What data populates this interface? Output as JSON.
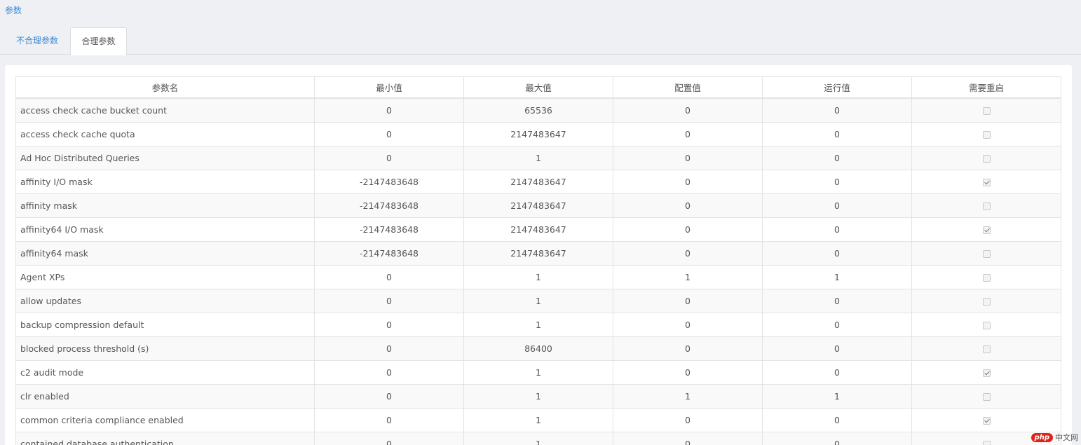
{
  "page": {
    "title": "参数"
  },
  "tabs": [
    {
      "label": "不合理参数",
      "active": false
    },
    {
      "label": "合理参数",
      "active": true
    }
  ],
  "table": {
    "columns": [
      "参数名",
      "最小值",
      "最大值",
      "配置值",
      "运行值",
      "需要重启"
    ],
    "rows": [
      {
        "name": "access check cache bucket count",
        "min": "0",
        "max": "65536",
        "config": "0",
        "run": "0",
        "restart": false
      },
      {
        "name": "access check cache quota",
        "min": "0",
        "max": "2147483647",
        "config": "0",
        "run": "0",
        "restart": false
      },
      {
        "name": "Ad Hoc Distributed Queries",
        "min": "0",
        "max": "1",
        "config": "0",
        "run": "0",
        "restart": false
      },
      {
        "name": "affinity I/O mask",
        "min": "-2147483648",
        "max": "2147483647",
        "config": "0",
        "run": "0",
        "restart": true
      },
      {
        "name": "affinity mask",
        "min": "-2147483648",
        "max": "2147483647",
        "config": "0",
        "run": "0",
        "restart": false
      },
      {
        "name": "affinity64 I/O mask",
        "min": "-2147483648",
        "max": "2147483647",
        "config": "0",
        "run": "0",
        "restart": true
      },
      {
        "name": "affinity64 mask",
        "min": "-2147483648",
        "max": "2147483647",
        "config": "0",
        "run": "0",
        "restart": false
      },
      {
        "name": "Agent XPs",
        "min": "0",
        "max": "1",
        "config": "1",
        "run": "1",
        "restart": false
      },
      {
        "name": "allow updates",
        "min": "0",
        "max": "1",
        "config": "0",
        "run": "0",
        "restart": false
      },
      {
        "name": "backup compression default",
        "min": "0",
        "max": "1",
        "config": "0",
        "run": "0",
        "restart": false
      },
      {
        "name": "blocked process threshold (s)",
        "min": "0",
        "max": "86400",
        "config": "0",
        "run": "0",
        "restart": false
      },
      {
        "name": "c2 audit mode",
        "min": "0",
        "max": "1",
        "config": "0",
        "run": "0",
        "restart": true
      },
      {
        "name": "clr enabled",
        "min": "0",
        "max": "1",
        "config": "1",
        "run": "1",
        "restart": false
      },
      {
        "name": "common criteria compliance enabled",
        "min": "0",
        "max": "1",
        "config": "0",
        "run": "0",
        "restart": true
      },
      {
        "name": "contained database authentication",
        "min": "0",
        "max": "1",
        "config": "0",
        "run": "0",
        "restart": false
      }
    ]
  },
  "watermark": {
    "logo": "php",
    "text": "中文网"
  }
}
